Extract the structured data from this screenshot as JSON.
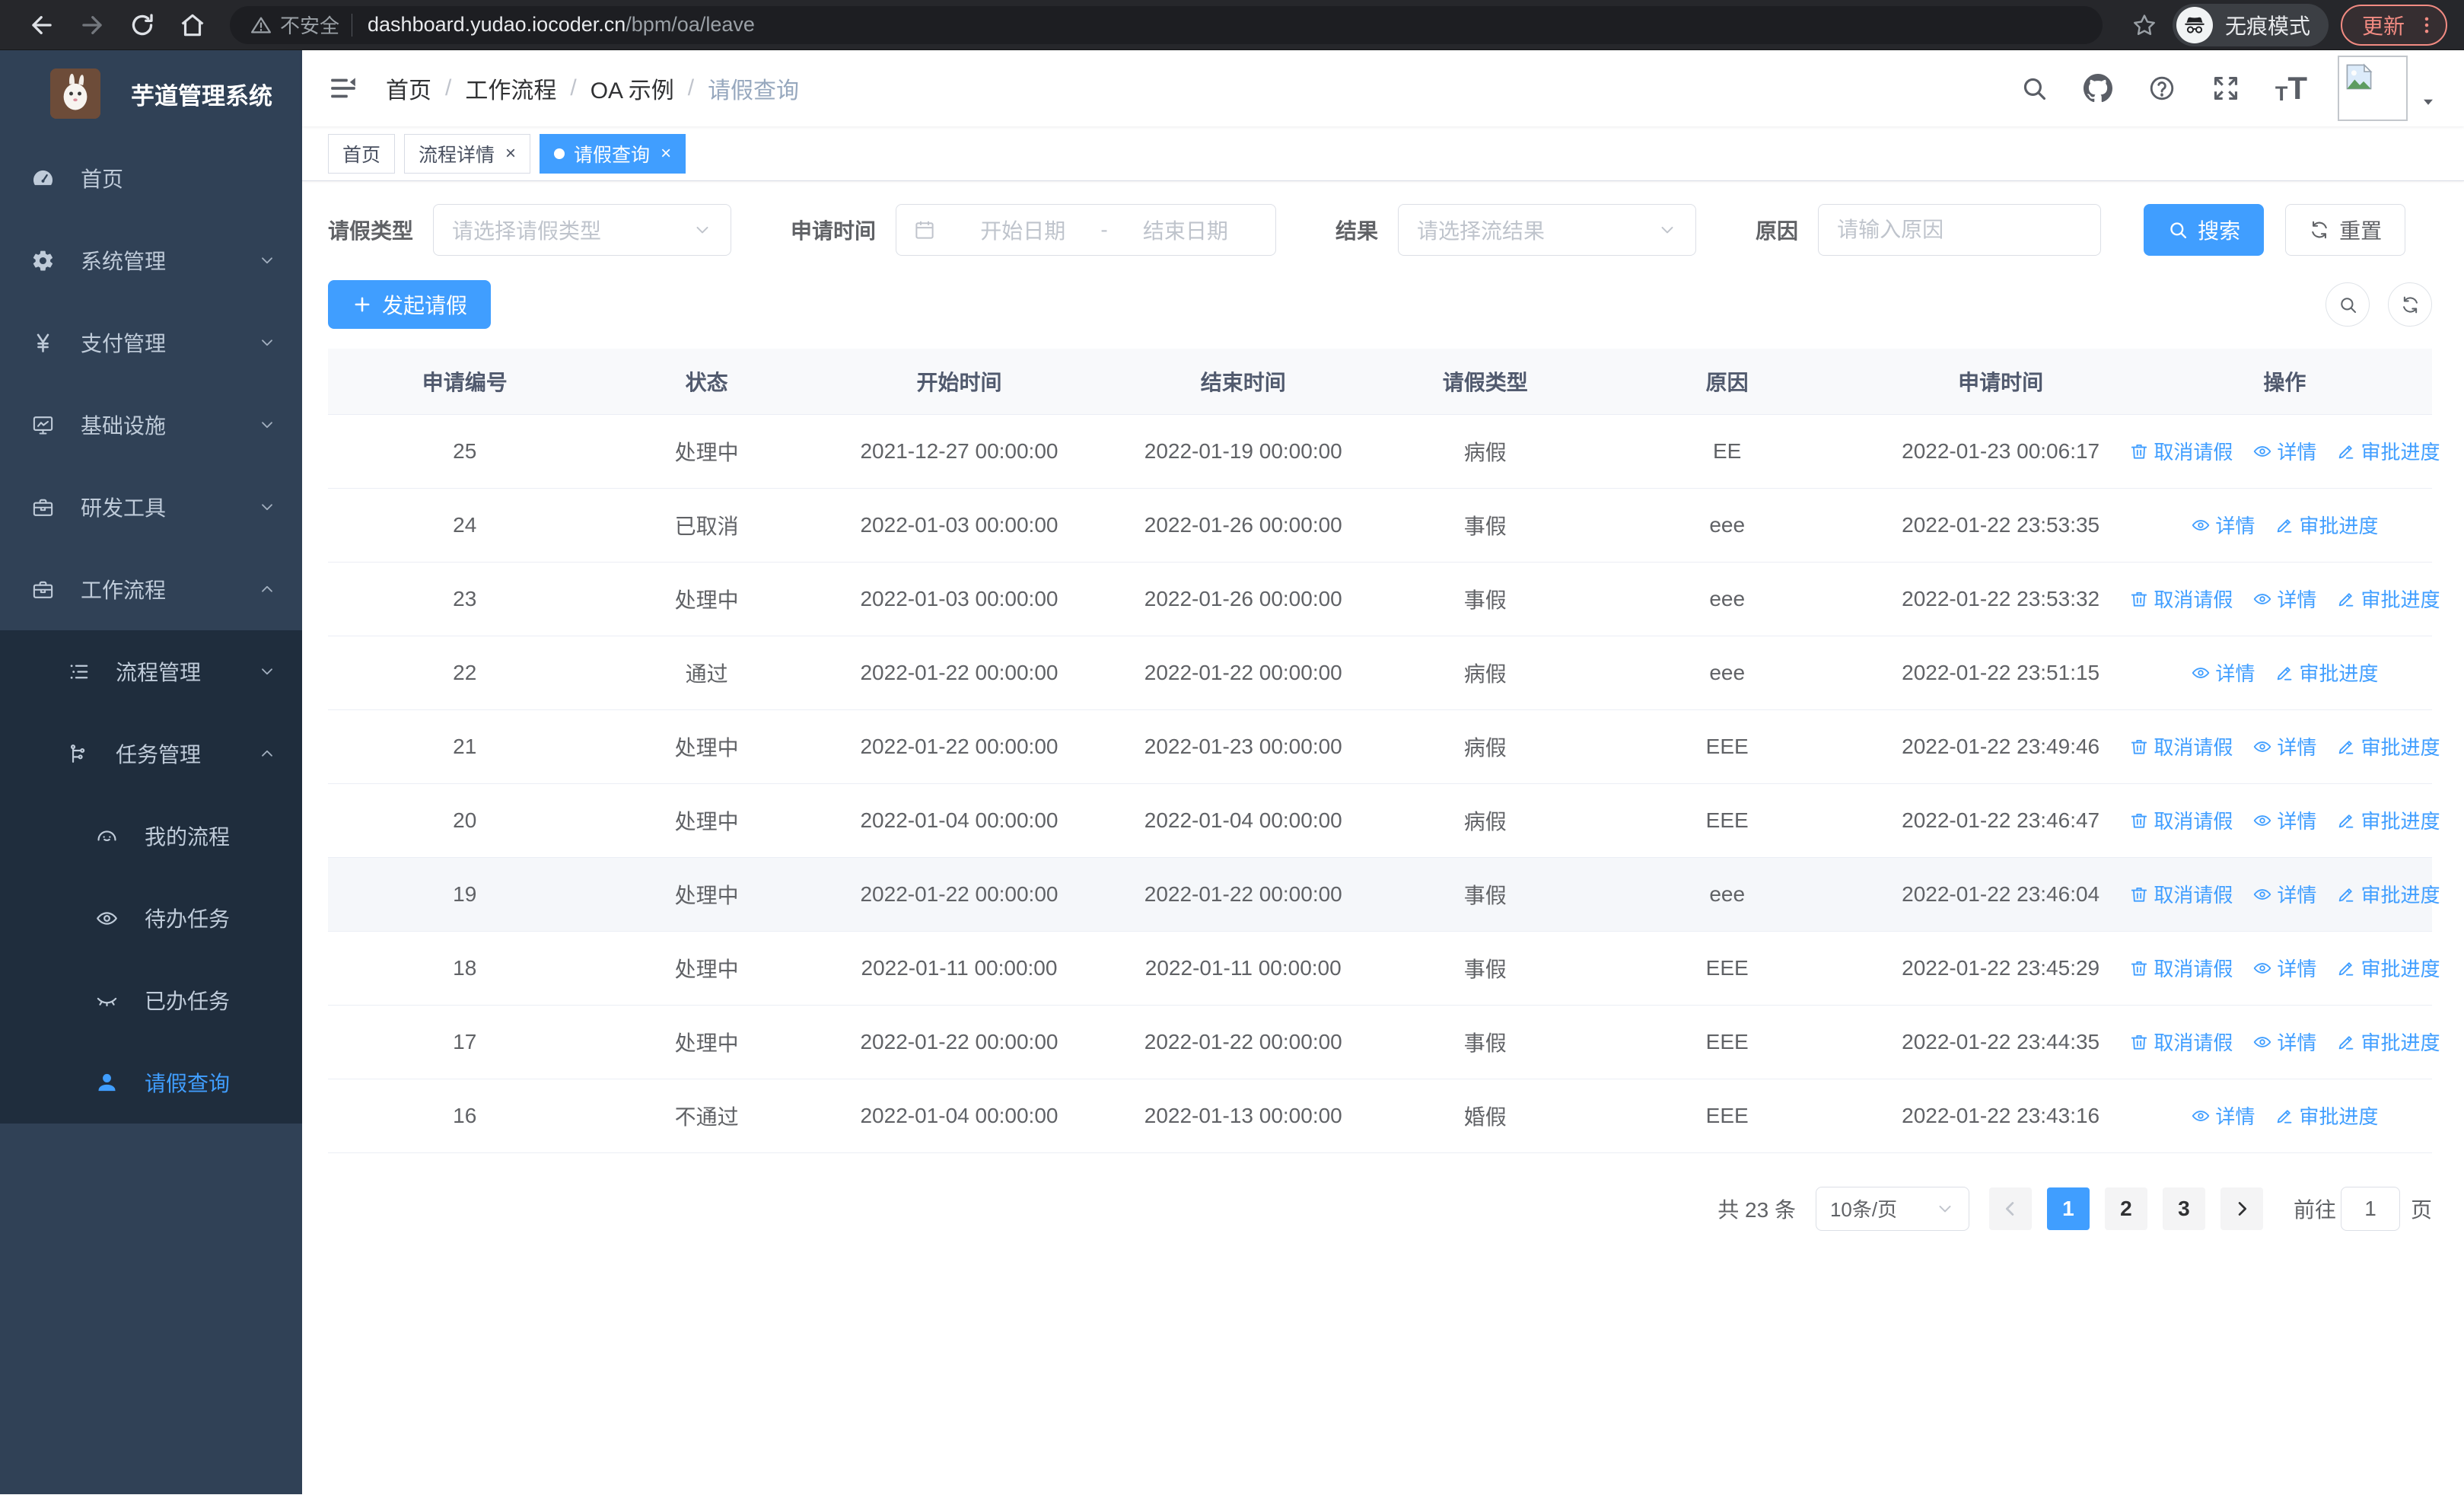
{
  "browser": {
    "security_label": "不安全",
    "url_host": "dashboard.yudao.iocoder.cn",
    "url_path": "/bpm/oa/leave",
    "incognito_label": "无痕模式",
    "update_label": "更新"
  },
  "sidebar": {
    "title": "芋道管理系统",
    "items": [
      {
        "name": "home",
        "label": "首页",
        "icon": "dashboard-icon",
        "glyph": "dashboard",
        "level": 1,
        "expandable": false,
        "expanded": false,
        "in_submenu": false,
        "active": false
      },
      {
        "name": "system-management",
        "label": "系统管理",
        "icon": "gear-icon",
        "glyph": "gear",
        "level": 1,
        "expandable": true,
        "expanded": false,
        "in_submenu": false,
        "active": false
      },
      {
        "name": "payment-management",
        "label": "支付管理",
        "icon": "yen-icon",
        "glyph": "yen",
        "level": 1,
        "expandable": true,
        "expanded": false,
        "in_submenu": false,
        "active": false
      },
      {
        "name": "infrastructure",
        "label": "基础设施",
        "icon": "monitor-icon",
        "glyph": "monitor",
        "level": 1,
        "expandable": true,
        "expanded": false,
        "in_submenu": false,
        "active": false
      },
      {
        "name": "dev-tools",
        "label": "研发工具",
        "icon": "toolbox-icon",
        "glyph": "toolbox",
        "level": 1,
        "expandable": true,
        "expanded": false,
        "in_submenu": false,
        "active": false
      },
      {
        "name": "workflow",
        "label": "工作流程",
        "icon": "briefcase-icon",
        "glyph": "toolbox",
        "level": 1,
        "expandable": true,
        "expanded": true,
        "in_submenu": false,
        "active": false
      },
      {
        "name": "process-management",
        "label": "流程管理",
        "icon": "list-icon",
        "glyph": "list",
        "level": 2,
        "expandable": true,
        "expanded": false,
        "in_submenu": true,
        "active": false
      },
      {
        "name": "task-management",
        "label": "任务管理",
        "icon": "flow-icon",
        "glyph": "flow",
        "level": 2,
        "expandable": true,
        "expanded": true,
        "in_submenu": true,
        "active": false
      },
      {
        "name": "my-process",
        "label": "我的流程",
        "icon": "service-face-icon",
        "glyph": "face",
        "level": 3,
        "expandable": false,
        "expanded": false,
        "in_submenu": true,
        "active": false
      },
      {
        "name": "todo-tasks",
        "label": "待办任务",
        "icon": "eye-open-icon",
        "glyph": "eyeOpen",
        "level": 3,
        "expandable": false,
        "expanded": false,
        "in_submenu": true,
        "active": false
      },
      {
        "name": "done-tasks",
        "label": "已办任务",
        "icon": "eye-closed-icon",
        "glyph": "eyeClosed",
        "level": 3,
        "expandable": false,
        "expanded": false,
        "in_submenu": true,
        "active": false
      },
      {
        "name": "leave-query",
        "label": "请假查询",
        "icon": "user-icon",
        "glyph": "user",
        "level": 3,
        "expandable": false,
        "expanded": false,
        "in_submenu": true,
        "active": true
      }
    ]
  },
  "breadcrumb": [
    "首页",
    "工作流程",
    "OA 示例",
    "请假查询"
  ],
  "tabs": [
    {
      "label": "首页",
      "closable": false,
      "active": false
    },
    {
      "label": "流程详情",
      "closable": true,
      "active": false
    },
    {
      "label": "请假查询",
      "closable": true,
      "active": true
    }
  ],
  "search_form": {
    "leave_type_label": "请假类型",
    "leave_type_placeholder": "请选择请假类型",
    "apply_time_label": "申请时间",
    "start_date_placeholder": "开始日期",
    "date_separator": "-",
    "end_date_placeholder": "结束日期",
    "result_label": "结果",
    "result_placeholder": "请选择流结果",
    "reason_label": "原因",
    "reason_placeholder": "请输入原因",
    "search_button": "搜索",
    "reset_button": "重置"
  },
  "toolbar": {
    "create_button": "发起请假"
  },
  "table": {
    "columns": [
      "申请编号",
      "状态",
      "开始时间",
      "结束时间",
      "请假类型",
      "原因",
      "申请时间",
      "操作"
    ],
    "action_labels": {
      "cancel": "取消请假",
      "detail": "详情",
      "progress": "审批进度"
    },
    "rows": [
      {
        "id": "25",
        "status": "处理中",
        "start": "2021-12-27 00:00:00",
        "end": "2022-01-19 00:00:00",
        "type": "病假",
        "reason": "EE",
        "apply_time": "2022-01-23 00:06:17",
        "actions": [
          "cancel",
          "detail",
          "progress"
        ],
        "hover": false
      },
      {
        "id": "24",
        "status": "已取消",
        "start": "2022-01-03 00:00:00",
        "end": "2022-01-26 00:00:00",
        "type": "事假",
        "reason": "eee",
        "apply_time": "2022-01-22 23:53:35",
        "actions": [
          "detail",
          "progress"
        ],
        "hover": false
      },
      {
        "id": "23",
        "status": "处理中",
        "start": "2022-01-03 00:00:00",
        "end": "2022-01-26 00:00:00",
        "type": "事假",
        "reason": "eee",
        "apply_time": "2022-01-22 23:53:32",
        "actions": [
          "cancel",
          "detail",
          "progress"
        ],
        "hover": false
      },
      {
        "id": "22",
        "status": "通过",
        "start": "2022-01-22 00:00:00",
        "end": "2022-01-22 00:00:00",
        "type": "病假",
        "reason": "eee",
        "apply_time": "2022-01-22 23:51:15",
        "actions": [
          "detail",
          "progress"
        ],
        "hover": false
      },
      {
        "id": "21",
        "status": "处理中",
        "start": "2022-01-22 00:00:00",
        "end": "2022-01-23 00:00:00",
        "type": "病假",
        "reason": "EEE",
        "apply_time": "2022-01-22 23:49:46",
        "actions": [
          "cancel",
          "detail",
          "progress"
        ],
        "hover": false
      },
      {
        "id": "20",
        "status": "处理中",
        "start": "2022-01-04 00:00:00",
        "end": "2022-01-04 00:00:00",
        "type": "病假",
        "reason": "EEE",
        "apply_time": "2022-01-22 23:46:47",
        "actions": [
          "cancel",
          "detail",
          "progress"
        ],
        "hover": false
      },
      {
        "id": "19",
        "status": "处理中",
        "start": "2022-01-22 00:00:00",
        "end": "2022-01-22 00:00:00",
        "type": "事假",
        "reason": "eee",
        "apply_time": "2022-01-22 23:46:04",
        "actions": [
          "cancel",
          "detail",
          "progress"
        ],
        "hover": true
      },
      {
        "id": "18",
        "status": "处理中",
        "start": "2022-01-11 00:00:00",
        "end": "2022-01-11 00:00:00",
        "type": "事假",
        "reason": "EEE",
        "apply_time": "2022-01-22 23:45:29",
        "actions": [
          "cancel",
          "detail",
          "progress"
        ],
        "hover": false
      },
      {
        "id": "17",
        "status": "处理中",
        "start": "2022-01-22 00:00:00",
        "end": "2022-01-22 00:00:00",
        "type": "事假",
        "reason": "EEE",
        "apply_time": "2022-01-22 23:44:35",
        "actions": [
          "cancel",
          "detail",
          "progress"
        ],
        "hover": false
      },
      {
        "id": "16",
        "status": "不通过",
        "start": "2022-01-04 00:00:00",
        "end": "2022-01-13 00:00:00",
        "type": "婚假",
        "reason": "EEE",
        "apply_time": "2022-01-22 23:43:16",
        "actions": [
          "detail",
          "progress"
        ],
        "hover": false
      }
    ]
  },
  "pagination": {
    "total_label": "共 23 条",
    "page_size": "10条/页",
    "pages": [
      "1",
      "2",
      "3"
    ],
    "active_page": "1",
    "goto_label": "前往",
    "goto_value": "1",
    "page_suffix_label": "页"
  },
  "colors": {
    "accent": "#409eff",
    "sidebar_bg": "#304156",
    "submenu_bg": "#1f2d3d",
    "sidebar_text": "#bfcbd9",
    "chrome_bg": "#26272b",
    "update_accent": "#f28b82",
    "table_header_bg": "#f8f9fb",
    "row_hover_bg": "#f5f7fa",
    "border": "#dcdfe6",
    "text_primary": "#303133",
    "text_regular": "#606266",
    "breadcrumb_muted": "#97a8be"
  }
}
